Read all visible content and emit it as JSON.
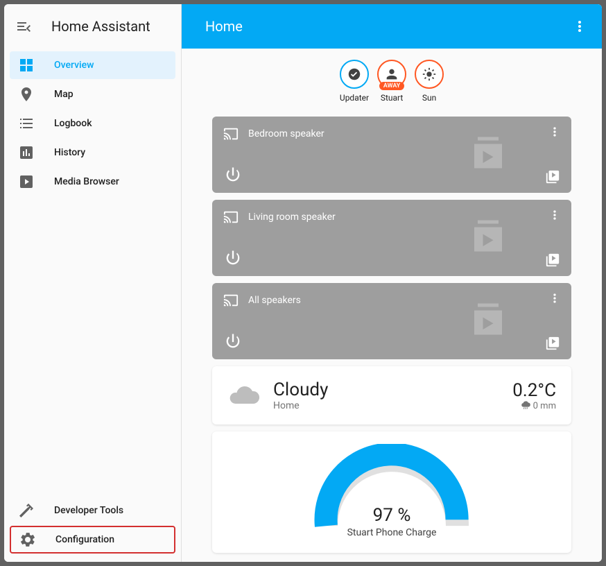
{
  "app_title": "Home Assistant",
  "topbar": {
    "title": "Home"
  },
  "sidebar": {
    "items": [
      {
        "label": "Overview"
      },
      {
        "label": "Map"
      },
      {
        "label": "Logbook"
      },
      {
        "label": "History"
      },
      {
        "label": "Media Browser"
      }
    ],
    "bottom": [
      {
        "label": "Developer Tools"
      },
      {
        "label": "Configuration"
      }
    ]
  },
  "chips": [
    {
      "label": "Updater",
      "icon": "check"
    },
    {
      "label": "Stuart",
      "icon": "person",
      "badge": "AWAY"
    },
    {
      "label": "Sun",
      "icon": "sun"
    }
  ],
  "media": [
    {
      "title": "Bedroom speaker"
    },
    {
      "title": "Living room speaker"
    },
    {
      "title": "All speakers"
    }
  ],
  "weather": {
    "condition": "Cloudy",
    "location": "Home",
    "temp": "0.2°C",
    "precip": "0 mm"
  },
  "gauge": {
    "value": "97 %",
    "label": "Stuart Phone Charge",
    "percent": 97
  },
  "colors": {
    "accent": "#03a9f4",
    "orange": "#ff5722",
    "gray": "#9e9e9e"
  }
}
